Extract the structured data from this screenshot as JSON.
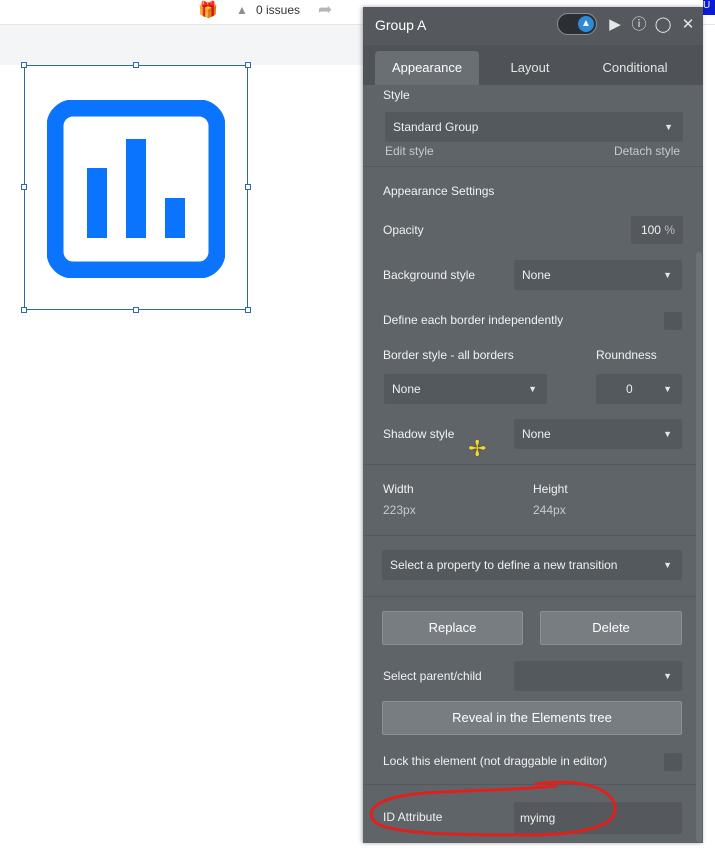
{
  "topbar": {
    "issues_label": "0 issues",
    "up_tag": "U",
    "icons": [
      "gift-icon",
      "warning-icon",
      "pointer-icon"
    ]
  },
  "canvas": {
    "element_icon": "bar-chart-icon",
    "accent_color": "#0a74ff"
  },
  "panel": {
    "title": "Group A",
    "header_icons": [
      "preview-toggle",
      "play-icon",
      "info-icon",
      "comment-icon",
      "close-icon"
    ],
    "tabs": [
      {
        "label": "Appearance",
        "active": true
      },
      {
        "label": "Layout",
        "active": false
      },
      {
        "label": "Conditional",
        "active": false
      }
    ],
    "style_label": "Style",
    "style_value": "Standard Group",
    "edit_style": "Edit style",
    "detach_style": "Detach style",
    "appearance_settings": "Appearance Settings",
    "opacity_label": "Opacity",
    "opacity_value": "100",
    "opacity_unit": "%",
    "background_style_label": "Background style",
    "background_style_value": "None",
    "define_borders_label": "Define each border independently",
    "border_style_label": "Border style - all borders",
    "border_style_value": "None",
    "roundness_label": "Roundness",
    "roundness_value": "0",
    "shadow_style_label": "Shadow style",
    "shadow_style_value": "None",
    "width_label": "Width",
    "width_value": "223px",
    "height_label": "Height",
    "height_value": "244px",
    "transition_placeholder": "Select a property to define a new transition",
    "replace_button": "Replace",
    "delete_button": "Delete",
    "select_parent_label": "Select parent/child",
    "select_parent_value": "",
    "reveal_button": "Reveal in the Elements tree",
    "lock_label": "Lock this element (not draggable in editor)",
    "id_attribute_label": "ID Attribute",
    "id_attribute_value": "myimg",
    "annotation_color": "#e0201d"
  }
}
